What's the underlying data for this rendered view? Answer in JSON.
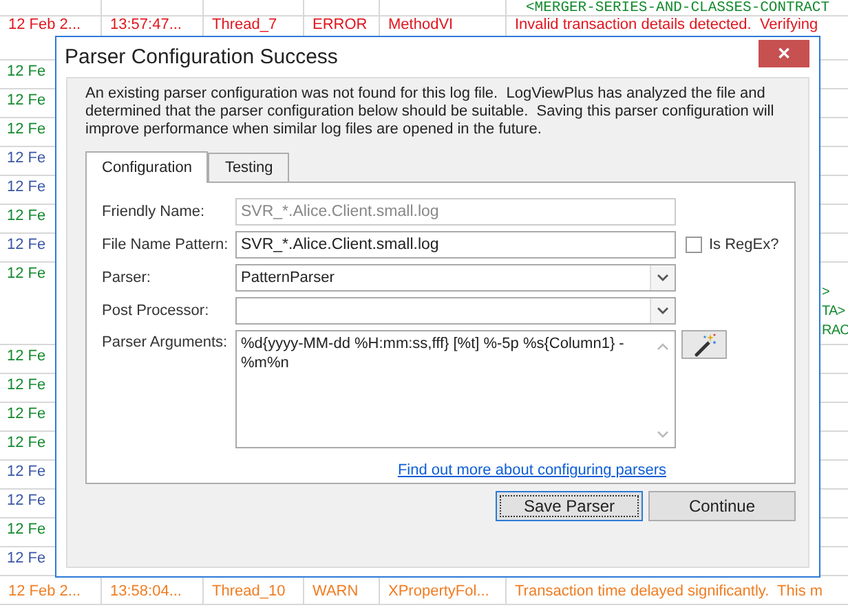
{
  "log_rows": [
    {
      "kind": "info",
      "cells": [
        "",
        "",
        "",
        "",
        "",
        "<MERGER-SERIES-AND-CLASSES-CONTRACT"
      ]
    },
    {
      "kind": "error",
      "cells": [
        "12 Feb 2...",
        "13:57:47...",
        "Thread_7",
        "ERROR",
        "MethodVI",
        "Invalid transaction details detected.  Verifying"
      ]
    },
    {
      "kind": "info",
      "cells": [
        "12 Fe"
      ]
    },
    {
      "kind": "info",
      "cells": [
        "12 Fe"
      ]
    },
    {
      "kind": "info",
      "cells": [
        "12 Fe"
      ]
    },
    {
      "kind": "debug",
      "cells": [
        "12 Fe"
      ]
    },
    {
      "kind": "debug",
      "cells": [
        "12 Fe"
      ]
    },
    {
      "kind": "info",
      "cells": [
        "12 Fe"
      ]
    },
    {
      "kind": "debug",
      "cells": [
        "12 Fe"
      ]
    },
    {
      "kind": "info",
      "cells": [
        "12 Fe"
      ],
      "tail": [
        ">",
        "TA>",
        "RAC"
      ]
    },
    {
      "kind": "info",
      "cells": [
        "12 Fe"
      ]
    },
    {
      "kind": "info",
      "cells": [
        "12 Fe"
      ]
    },
    {
      "kind": "info",
      "cells": [
        "12 Fe"
      ]
    },
    {
      "kind": "info",
      "cells": [
        "12 Fe"
      ]
    },
    {
      "kind": "debug",
      "cells": [
        "12 Fe"
      ]
    },
    {
      "kind": "debug",
      "cells": [
        "12 Fe"
      ]
    },
    {
      "kind": "info",
      "cells": [
        "12 Fe"
      ]
    },
    {
      "kind": "debug",
      "cells": [
        "12 Fe"
      ]
    },
    {
      "kind": "warn",
      "cells": [
        "12 Feb 2...",
        "13:58:04...",
        "Thread_10",
        "WARN",
        "XPropertyFol...",
        "Transaction time delayed significantly.  This m"
      ]
    }
  ],
  "dialog": {
    "title": "Parser Configuration Success",
    "close": "✕",
    "message": "An existing parser configuration was not found for this log file.  LogViewPlus has analyzed the file and determined that the parser configuration below should be suitable.  Saving this parser configuration will improve performance when similar log files are opened in the future.",
    "tabs": [
      {
        "label": "Configuration",
        "selected": true
      },
      {
        "label": "Testing",
        "selected": false
      }
    ],
    "fields": [
      {
        "kind": "text",
        "label": "Friendly Name:",
        "value": "SVR_*.Alice.Client.small.log",
        "disabled": true
      },
      {
        "kind": "text",
        "label": "File Name Pattern:",
        "value": "SVR_*.Alice.Client.small.log",
        "disabled": false,
        "checkbox": {
          "label": "Is RegEx?",
          "checked": false
        }
      },
      {
        "kind": "select",
        "label": "Parser:",
        "value": "PatternParser"
      },
      {
        "kind": "select",
        "label": "Post Processor:"
      },
      {
        "kind": "textarea",
        "label": "Parser Arguments:",
        "value": "%d{yyyy-MM-dd %H:mm:ss,fff} [%t] %-5p %s{Column1} - %m%n"
      }
    ],
    "link": "Find out more about configuring parsers",
    "buttons": [
      {
        "label": "Save Parser",
        "default": true
      },
      {
        "label": "Continue",
        "default": false
      }
    ]
  }
}
